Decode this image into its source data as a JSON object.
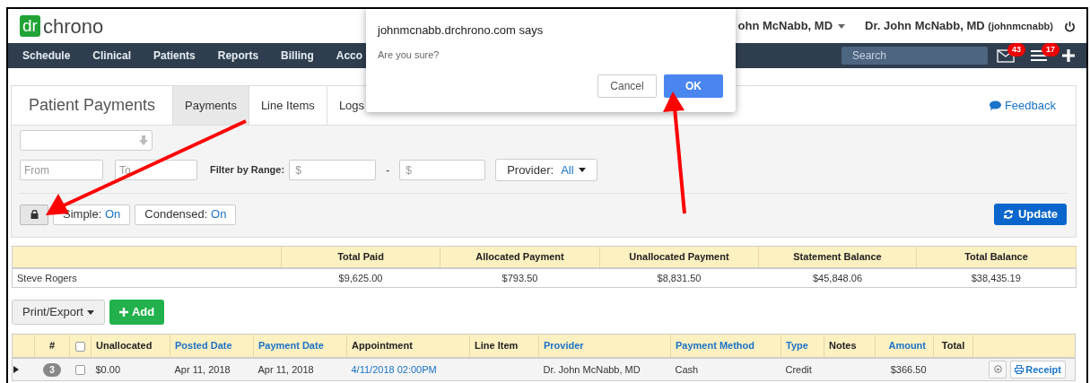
{
  "header": {
    "logo": {
      "mark": "dr",
      "word": "chrono"
    },
    "user_menu": "ohn McNabb, MD",
    "account": {
      "name": "Dr. John McNabb, MD",
      "username": "(johnmcnabb)"
    }
  },
  "nav": {
    "items": [
      "Schedule",
      "Clinical",
      "Patients",
      "Reports",
      "Billing",
      "Acco"
    ],
    "search": {
      "placeholder": "Search"
    },
    "badges": [
      {
        "kind": "mail",
        "count": "43"
      },
      {
        "kind": "list",
        "count": "17"
      }
    ]
  },
  "dialog": {
    "title": "johnmcnabb.drchrono.com says",
    "message": "Are you sure?",
    "buttons": [
      {
        "label": "Cancel",
        "primary": false
      },
      {
        "label": "OK",
        "primary": true
      }
    ]
  },
  "panel": {
    "title": "Patient Payments",
    "tabs": [
      {
        "label": "Payments",
        "selected": true
      },
      {
        "label": "Line Items",
        "selected": false
      },
      {
        "label": "Logs",
        "selected": false
      }
    ],
    "feedback": "Feedback"
  },
  "filters": {
    "date_from": {
      "placeholder": "From"
    },
    "date_to": {
      "placeholder": "To"
    },
    "range_label": "Filter by Range:",
    "range_min": {
      "placeholder": "$"
    },
    "range_separator": "-",
    "range_max": {
      "placeholder": "$"
    },
    "provider": {
      "label": "Provider:",
      "value": "All"
    },
    "toggles": [
      {
        "label": "Simple:",
        "value": "On"
      },
      {
        "label": "Condensed:",
        "value": "On"
      }
    ],
    "update": "Update"
  },
  "summary": {
    "columns": [
      "Total Paid",
      "Allocated Payment",
      "Unallocated Payment",
      "Statement Balance",
      "Total Balance"
    ],
    "row": {
      "patient": "Steve Rogers",
      "values": [
        "$9,625.00",
        "$793.50",
        "$8,831.50",
        "$45,848.06",
        "$38,435.19"
      ]
    }
  },
  "actions": {
    "export": "Print/Export",
    "add": "Add"
  },
  "payments": {
    "select_all_checked": false,
    "columns": [
      {
        "label": "#",
        "sortable": false
      },
      {
        "label": "Unallocated",
        "sortable": false
      },
      {
        "label": "Posted Date",
        "sortable": true
      },
      {
        "label": "Payment Date",
        "sortable": true
      },
      {
        "label": "Appointment",
        "sortable": false
      },
      {
        "label": "Line Item",
        "sortable": false
      },
      {
        "label": "Provider",
        "sortable": true
      },
      {
        "label": "Payment Method",
        "sortable": true
      },
      {
        "label": "Type",
        "sortable": true
      },
      {
        "label": "Notes",
        "sortable": false
      },
      {
        "label": "Amount",
        "sortable": true
      },
      {
        "label": "Total",
        "sortable": false
      }
    ],
    "rows": [
      {
        "expanded": false,
        "count": "3",
        "checked": false,
        "unallocated": "$0.00",
        "posted_date": "Apr 11, 2018",
        "payment_date": "Apr 11, 2018",
        "appointment": "4/11/2018 02:00PM",
        "provider": "Dr. John McNabb, MD",
        "payment_method": "Cash",
        "type": "Credit",
        "amount": "$366.50",
        "receipt": "Receipt"
      }
    ]
  }
}
